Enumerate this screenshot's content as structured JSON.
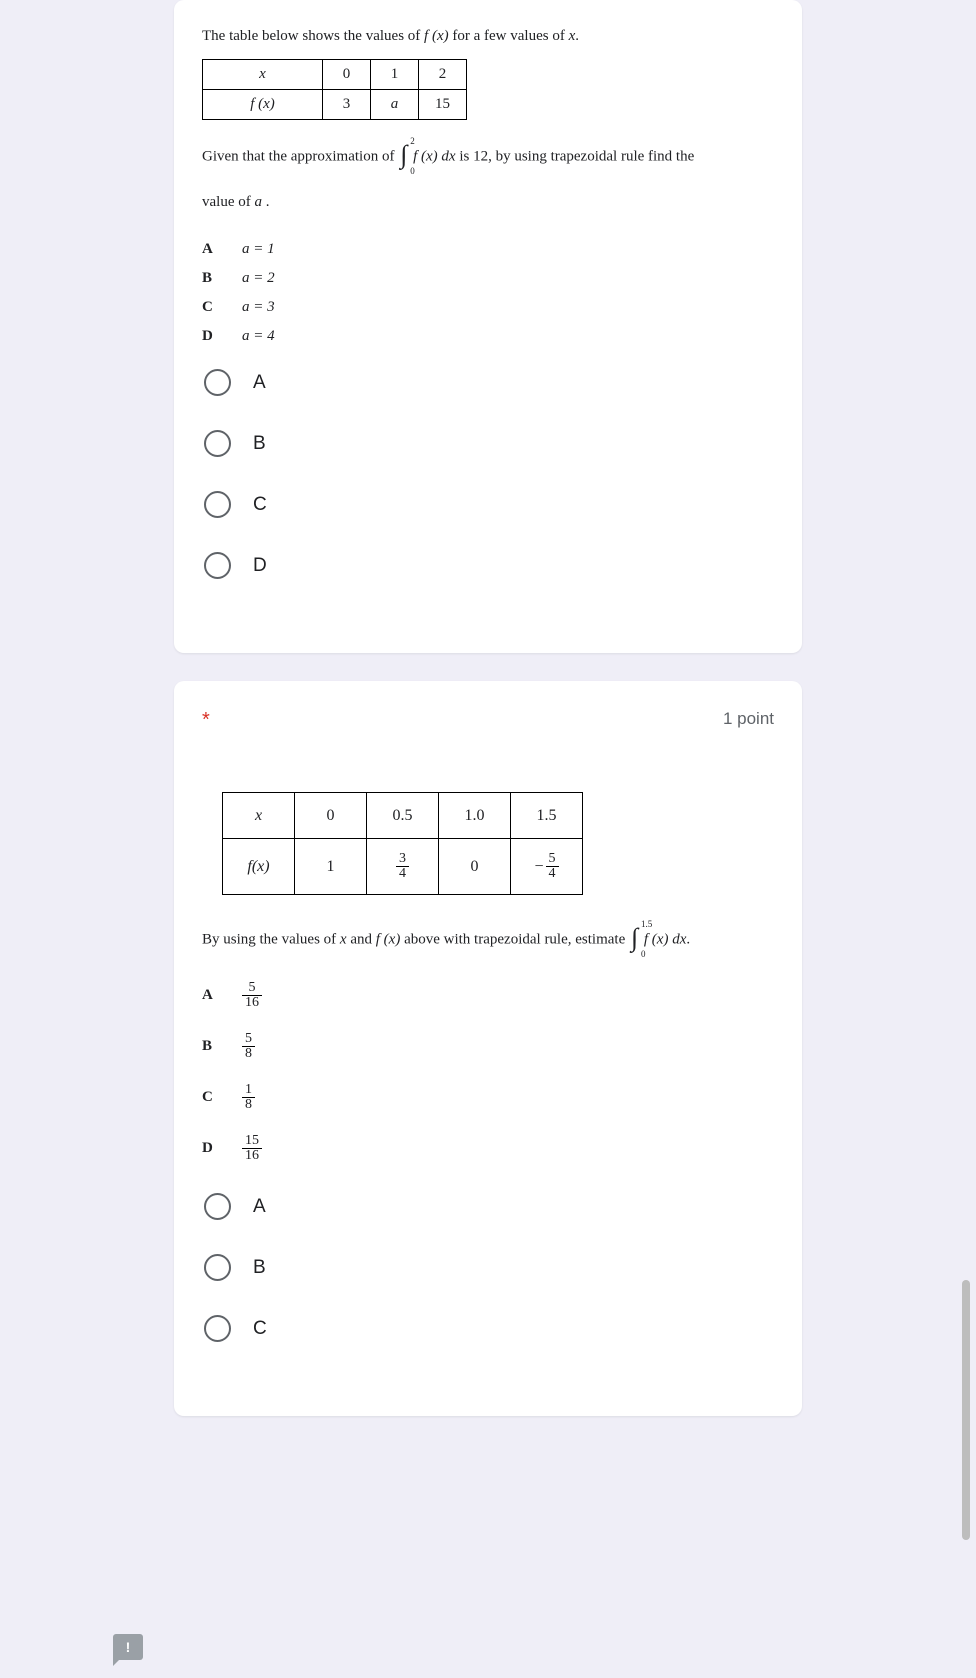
{
  "q1": {
    "intro_pre": "The table below shows the values of ",
    "intro_fx": "f (x)",
    "intro_post": " for a few values of ",
    "intro_var": "x",
    "intro_end": ".",
    "table": {
      "r1c1": "x",
      "r1c2": "0",
      "r1c3": "1",
      "r1c4": "2",
      "r2c1": "f (x)",
      "r2c2": "3",
      "r2c3": "a",
      "r2c4": "15"
    },
    "given_pre": "Given that the approximation of ",
    "int_up": "2",
    "int_lo": "0",
    "given_mid1": "f (x) dx",
    "given_mid2": " is 12, by using trapezoidal rule find the",
    "valueof": "value of ",
    "valuevar": "a",
    "valueend": " .",
    "choices": [
      {
        "label": "A",
        "text": "a = 1"
      },
      {
        "label": "B",
        "text": "a = 2"
      },
      {
        "label": "C",
        "text": "a = 3"
      },
      {
        "label": "D",
        "text": "a = 4"
      }
    ],
    "radios": [
      "A",
      "B",
      "C",
      "D"
    ]
  },
  "q2": {
    "asterisk": "*",
    "points": "1 point",
    "table": {
      "r1": [
        "x",
        "0",
        "0.5",
        "1.0",
        "1.5"
      ],
      "r2_head": "f(x)",
      "r2_1": "1",
      "r2_2": {
        "n": "3",
        "d": "4"
      },
      "r2_3": "0",
      "r2_4": {
        "minus": "−",
        "n": "5",
        "d": "4"
      }
    },
    "stmt_pre": "By using the values of ",
    "stmt_x": "x",
    "stmt_mid1": " and ",
    "stmt_fx": "f (x)",
    "stmt_mid2": " above with trapezoidal rule,  estimate ",
    "int_up": "1.5",
    "int_lo": "0",
    "stmt_int": "f (x) dx",
    "stmt_end": ".",
    "choices": [
      {
        "label": "A",
        "n": "5",
        "d": "16"
      },
      {
        "label": "B",
        "n": "5",
        "d": "8"
      },
      {
        "label": "C",
        "n": "1",
        "d": "8"
      },
      {
        "label": "D",
        "n": "15",
        "d": "16"
      }
    ],
    "radios": [
      "A",
      "B",
      "C"
    ]
  },
  "feedback": "!"
}
